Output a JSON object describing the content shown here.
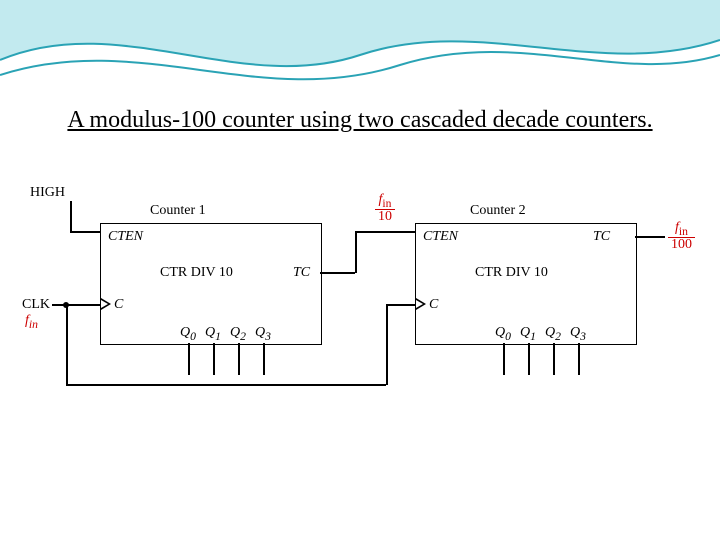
{
  "title": "A modulus-100 counter using two cascaded decade counters.",
  "labels": {
    "high": "HIGH",
    "clk": "CLK",
    "fin": "f",
    "fin_sub": "in",
    "counter1": "Counter 1",
    "counter2": "Counter 2",
    "cten": "CTEN",
    "ctr": "CTR DIV 10",
    "tc": "TC",
    "c": "C",
    "q0": "Q",
    "q0s": "0",
    "q1": "Q",
    "q1s": "1",
    "q2": "Q",
    "q2s": "2",
    "q3": "Q",
    "q3s": "3",
    "mid_num": "f",
    "mid_num_sub": "in",
    "mid_den": "10",
    "out_num": "f",
    "out_num_sub": "in",
    "out_den": "100"
  }
}
